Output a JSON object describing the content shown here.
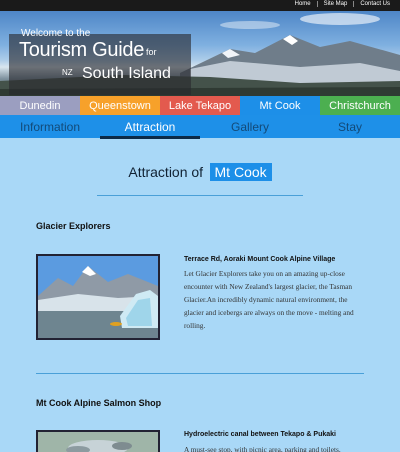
{
  "top_links": [
    "Home",
    "Site Map",
    "Contact Us"
  ],
  "hero": {
    "welcome": "Welcome to the",
    "tourism_guide": "Tourism Guide",
    "for": "for",
    "nz": "NZ",
    "south_island": "South Island"
  },
  "city_tabs": [
    {
      "label": "Dunedin",
      "color": "#9b9ec0"
    },
    {
      "label": "Queenstown",
      "color": "#f7a12a"
    },
    {
      "label": "Lake Tekapo",
      "color": "#e35a4e"
    },
    {
      "label": "Mt Cook",
      "color": "#1d8fe8"
    },
    {
      "label": "Christchurch",
      "color": "#4caf50"
    }
  ],
  "sub_tabs": [
    {
      "label": "Information",
      "active": false
    },
    {
      "label": "Attraction",
      "active": true
    },
    {
      "label": "Gallery",
      "active": false
    },
    {
      "label": "Stay",
      "active": false
    }
  ],
  "page_title": {
    "prefix": "Attraction of",
    "city": "Mt Cook"
  },
  "attractions": [
    {
      "name": "Glacier Explorers",
      "location": "Terrace Rd, Aoraki Mount Cook Alpine Village",
      "description": "Let Glacier Explorers take you on an amazing up-close encounter with New Zealand's largest glacier, the Tasman Glacier.An incredibly dynamic natural environment, the glacier and icebergs are always on the move - melting and rolling."
    },
    {
      "name": "Mt Cook Alpine Salmon Shop",
      "location": "Hydroelectric canal between Tekapo & Pukaki",
      "description": "A must-see stop, with picnic area, parking and toilets."
    }
  ],
  "colors": {
    "page_bg": "#a9d8f7",
    "nav_blue": "#1e90e8",
    "accent_dark": "#0c2a47"
  }
}
